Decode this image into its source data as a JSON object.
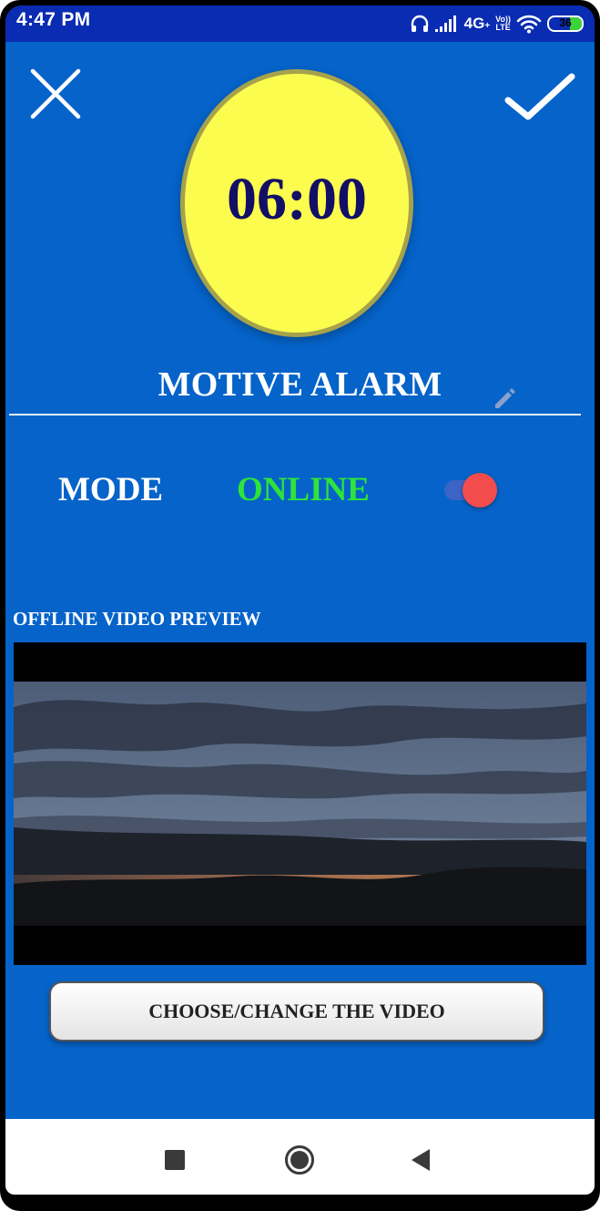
{
  "status_bar": {
    "time": "4:47 PM",
    "network": "4G",
    "network_suffix": "+",
    "volte_top": "Vo))",
    "volte_bottom": "LTE",
    "battery_level": "36",
    "battery_fraction": 0.36,
    "icons": [
      "headphones-icon",
      "signal-icon",
      "wifi-icon",
      "battery-icon"
    ]
  },
  "header": {
    "close_icon": "close-icon",
    "confirm_icon": "checkmark-icon"
  },
  "alarm": {
    "time": "06:00",
    "name": "MOTIVE ALARM",
    "edit_icon": "pencil-icon"
  },
  "mode": {
    "label": "MODE",
    "value": "ONLINE",
    "toggle_on": true
  },
  "preview": {
    "label": "OFFLINE VIDEO PREVIEW"
  },
  "actions": {
    "choose_video_label": "CHOOSE/CHANGE THE VIDEO"
  },
  "nav": {
    "items": [
      "recents-icon",
      "home-icon",
      "back-icon"
    ]
  },
  "colors": {
    "background": "#0563c9",
    "status_bar": "#0a2cb2",
    "clock_fill": "#fbfc4d",
    "clock_text": "#130e66",
    "online_green": "#2ee33a",
    "toggle_knob": "#f34c4c",
    "toggle_track": "#3c63c6"
  }
}
